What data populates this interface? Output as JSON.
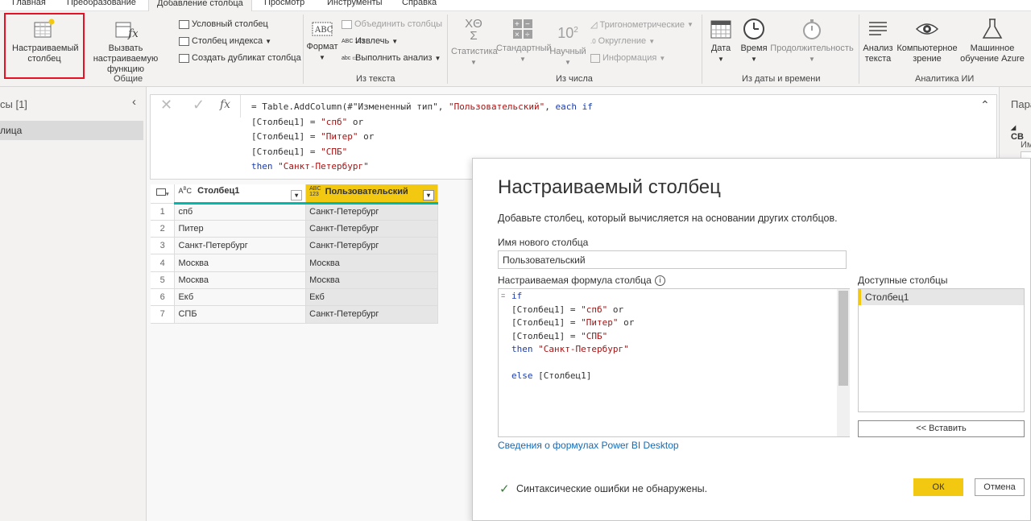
{
  "tabs": [
    "Главная",
    "Преобразование",
    "Добавление столбца",
    "Просмотр",
    "Инструменты",
    "Справка"
  ],
  "ribbon": {
    "general": {
      "custom_column": "Настраиваемый столбец",
      "invoke_function": "Вызвать настраиваемую функцию",
      "conditional": "Условный столбец",
      "index": "Столбец индекса",
      "duplicate": "Создать дубликат столбца",
      "group": "Общие"
    },
    "text": {
      "format": "Формат",
      "merge": "Объединить столбцы",
      "extract": "Извлечь",
      "parse": "Выполнить анализ",
      "group": "Из текста"
    },
    "number": {
      "stats": "Статистика",
      "standard": "Стандартный",
      "scientific": "Научный",
      "trig": "Тригонометрические",
      "round": "Округление",
      "info": "Информация",
      "group": "Из числа"
    },
    "datetime": {
      "date": "Дата",
      "time": "Время",
      "duration": "Продолжительность",
      "group": "Из даты и времени"
    },
    "ai": {
      "text_analytics": "Анализ текста",
      "vision": "Компьютерное зрение",
      "azure_ml": "Машинное обучение Azure",
      "group": "Аналитика ИИ"
    }
  },
  "left_pane": {
    "header": "сы [1]",
    "item": "лица"
  },
  "right_pane": {
    "header": "Пара",
    "section": "СВ",
    "sub": "Им"
  },
  "formula_bar": {
    "line1_prefix": "= Table.AddColumn(#\"Измененный тип\", ",
    "line1_str": "\"Пользовательский\"",
    "line1_sep": ", ",
    "line1_kw": "each if",
    "line2": "[Столбец1] = ",
    "line2_str": "\"спб\"",
    "line2_kw": " or",
    "line3": "[Столбец1] = ",
    "line3_str": "\"Питер\"",
    "line3_kw": " or",
    "line4": "[Столбец1] = ",
    "line4_str": "\"СПБ\"",
    "line5_kw": "then ",
    "line5_str": "\"Санкт-Петербург\""
  },
  "grid": {
    "col1": "Столбец1",
    "col2": "Пользовательский",
    "rows": [
      {
        "n": "1",
        "c1": "спб",
        "c2": "Санкт-Петербург"
      },
      {
        "n": "2",
        "c1": "Питер",
        "c2": "Санкт-Петербург"
      },
      {
        "n": "3",
        "c1": "Санкт-Петербург",
        "c2": "Санкт-Петербург"
      },
      {
        "n": "4",
        "c1": "Москва",
        "c2": "Москва"
      },
      {
        "n": "5",
        "c1": "Москва",
        "c2": "Москва"
      },
      {
        "n": "6",
        "c1": "Екб",
        "c2": "Екб"
      },
      {
        "n": "7",
        "c1": "СПБ",
        "c2": "Санкт-Петербург"
      }
    ]
  },
  "dialog": {
    "title": "Настраиваемый столбец",
    "subtitle": "Добавьте столбец, который вычисляется на основании других столбцов.",
    "name_label": "Имя нового столбца",
    "name_value": "Пользовательский",
    "formula_label": "Настраиваемая формула столбца",
    "formula": {
      "l1_kw": "if",
      "l2": "[Столбец1] = ",
      "l2_str": "\"спб\"",
      "l2_kw": " or",
      "l3": "[Столбец1] = ",
      "l3_str": "\"Питер\"",
      "l3_kw": " or",
      "l4": "[Столбец1] = ",
      "l4_str": "\"СПБ\"",
      "l5_kw": "then ",
      "l5_str": "\"Санкт-Петербург\"",
      "l7_kw": "else ",
      "l7": "[Столбец1]"
    },
    "available_label": "Доступные столбцы",
    "available_item": "Столбец1",
    "insert_button": "<< Вставить",
    "help_link": "Сведения о формулах Power BI Desktop",
    "status": "Синтаксические ошибки не обнаружены.",
    "ok": "ОК",
    "cancel": "Отмена"
  },
  "colors": {
    "highlight_border": "#e81123",
    "accent_yellow": "#f2c811",
    "teal_bar": "#01b8aa",
    "link": "#0f6cbd",
    "ok_green": "#3a7d3a"
  }
}
